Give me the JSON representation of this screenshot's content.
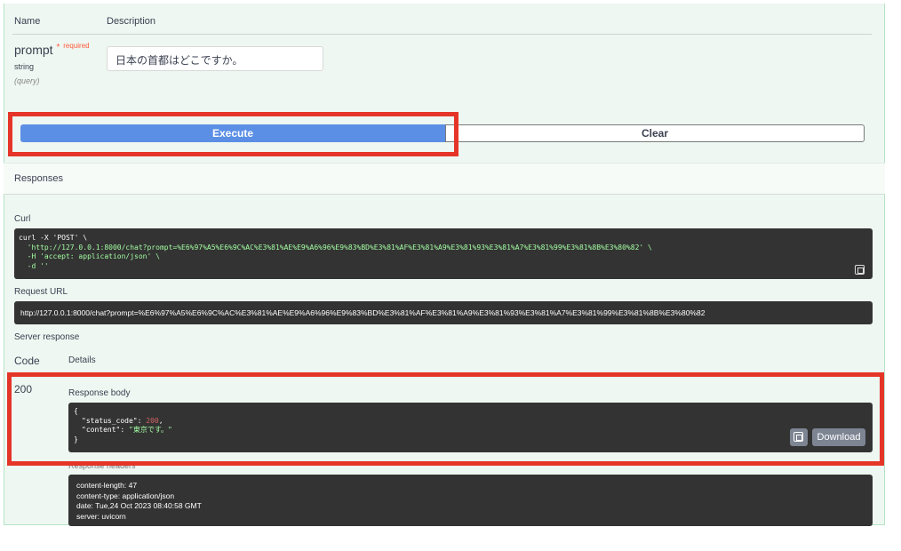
{
  "params": {
    "name_header": "Name",
    "desc_header": "Description",
    "param_name": "prompt",
    "required_star": "*",
    "required_label": "required",
    "param_type": "string",
    "param_location": "(query)",
    "input_value": "日本の首都はどこですか。"
  },
  "buttons": {
    "execute": "Execute",
    "clear": "Clear"
  },
  "responses": {
    "title": "Responses",
    "curl_label": "Curl",
    "curl_lines": [
      "curl -X 'POST' \\",
      "  'http://127.0.0.1:8000/chat?prompt=%E6%97%A5%E6%9C%AC%E3%81%AE%E9%A6%96%E9%83%BD%E3%81%AF%E3%81%A9%E3%81%93%E3%81%A7%E3%81%99%E3%81%8B%E3%80%82' \\",
      "  -H 'accept: application/json' \\",
      "  -d ''"
    ],
    "request_url_label": "Request URL",
    "request_url": "http://127.0.0.1:8000/chat?prompt=%E6%97%A5%E6%9C%AC%E3%81%AE%E9%A6%96%E9%83%BD%E3%81%AF%E3%81%A9%E3%81%93%E3%81%A7%E3%81%99%E3%81%8B%E3%80%82",
    "server_response_label": "Server response",
    "code_header": "Code",
    "details_header": "Details",
    "status_code": "200",
    "response_body_label": "Response body",
    "body": {
      "open": "{",
      "key1": "\"status_code\"",
      "val1": "200",
      "key2": "\"content\"",
      "val2": "\"東京です。\"",
      "close": "}"
    },
    "download_label": "Download",
    "headers_label": "Response headers",
    "headers": [
      "content-length: 47",
      "content-type: application/json",
      "date: Tue,24 Oct 2023 08:40:58 GMT",
      "server: uvicorn"
    ]
  },
  "colors": {
    "execute_bg": "#5b8fe6",
    "highlight_border": "#e53529",
    "panel_bg": "#eef7f1",
    "code_bg": "#333333"
  }
}
